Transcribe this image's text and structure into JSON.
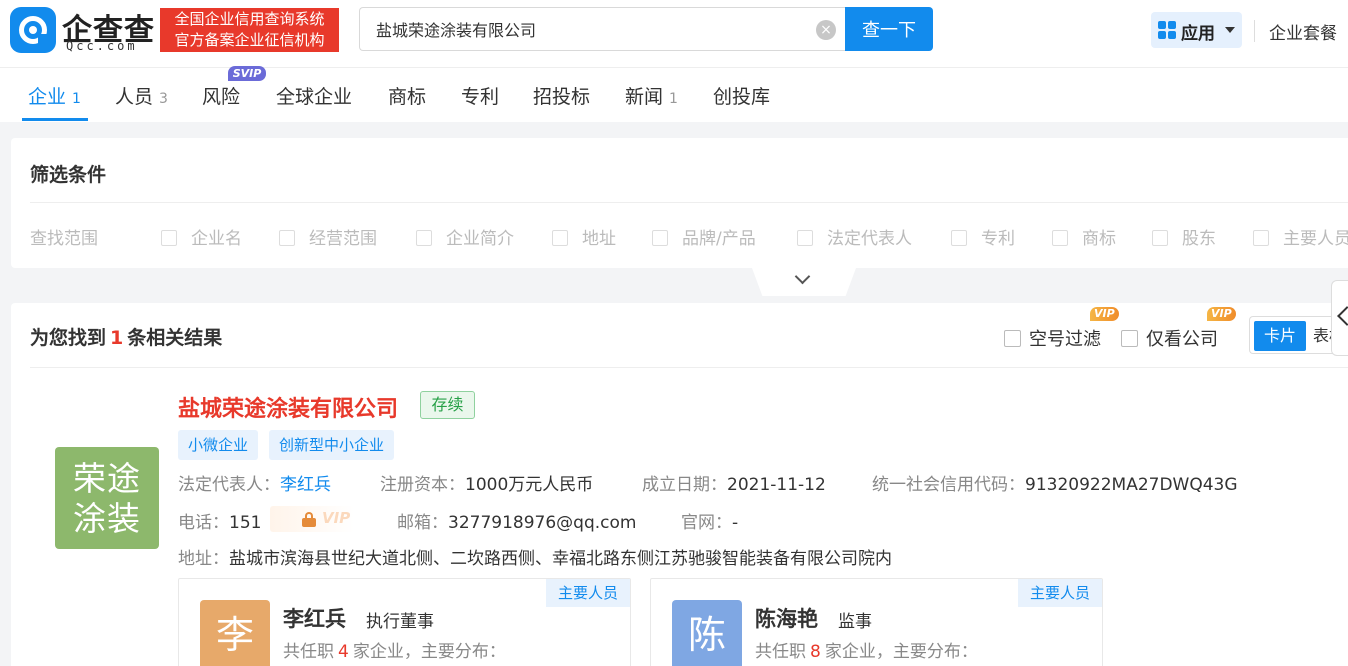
{
  "header": {
    "logo_text": "企查查",
    "logo_sub": "Qcc.com",
    "badge_line1": "全国企业信用查询系统",
    "badge_line2": "官方备案企业征信机构",
    "search_value": "盐城荣途涂装有限公司",
    "clear_symbol": "×",
    "search_button": "查一下",
    "app_label": "应用",
    "plan_link": "企业套餐"
  },
  "tabs": [
    {
      "label": "企业",
      "count": "1"
    },
    {
      "label": "人员",
      "count": "3"
    },
    {
      "label": "风险",
      "count": ""
    },
    {
      "label": "全球企业",
      "count": ""
    },
    {
      "label": "商标",
      "count": ""
    },
    {
      "label": "专利",
      "count": ""
    },
    {
      "label": "招投标",
      "count": ""
    },
    {
      "label": "新闻",
      "count": "1"
    },
    {
      "label": "创投库",
      "count": ""
    }
  ],
  "svip_badge": "SVIP",
  "filter": {
    "title": "筛选条件",
    "scope_label": "查找范围",
    "options": [
      "企业名",
      "经营范围",
      "企业简介",
      "地址",
      "品牌/产品",
      "法定代表人",
      "专利",
      "商标",
      "股东",
      "主要人员"
    ]
  },
  "results": {
    "prefix": "为您找到",
    "count": "1",
    "suffix": "条相关结果",
    "empty_filter": "空号过滤",
    "only_company": "仅看公司",
    "vip": "VIP",
    "view_card": "卡片",
    "view_table": "表格"
  },
  "company": {
    "logo_line1": "荣途",
    "logo_line2": "涂装",
    "name": "盐城荣途涂装有限公司",
    "status": "存续",
    "tags": [
      "小微企业",
      "创新型中小企业"
    ],
    "legal_rep_label": "法定代表人：",
    "legal_rep": "李红兵",
    "capital_label": "注册资本：",
    "capital": "1000万元人民币",
    "founded_label": "成立日期：",
    "founded": "2021-11-12",
    "credit_code_label": "统一社会信用代码：",
    "credit_code": "91320922MA27DWQ43G",
    "phone_label": "电话：",
    "phone": "151",
    "phone_vip": "VIP",
    "email_label": "邮箱：",
    "email": "3277918976@qq.com",
    "website_label": "官网：",
    "website": "-",
    "address_label": "地址：",
    "address": "盐城市滨海县世纪大道北侧、二坎路西侧、幸福北路东侧江苏驰骏智能装备有限公司院内"
  },
  "people": [
    {
      "tag": "主要人员",
      "avatar": "李",
      "avatar_color": "#e7a96a",
      "name": "李红兵",
      "role": "执行董事",
      "desc_prefix": "共任职",
      "count": "4",
      "desc_suffix": "家企业，主要分布："
    },
    {
      "tag": "主要人员",
      "avatar": "陈",
      "avatar_color": "#7fa7e3",
      "name": "陈海艳",
      "role": "监事",
      "desc_prefix": "共任职",
      "count": "8",
      "desc_suffix": "家企业，主要分布："
    }
  ],
  "colors": {
    "brand": "#128bed",
    "highlight": "#e8392b",
    "status_green": "#27a047"
  }
}
